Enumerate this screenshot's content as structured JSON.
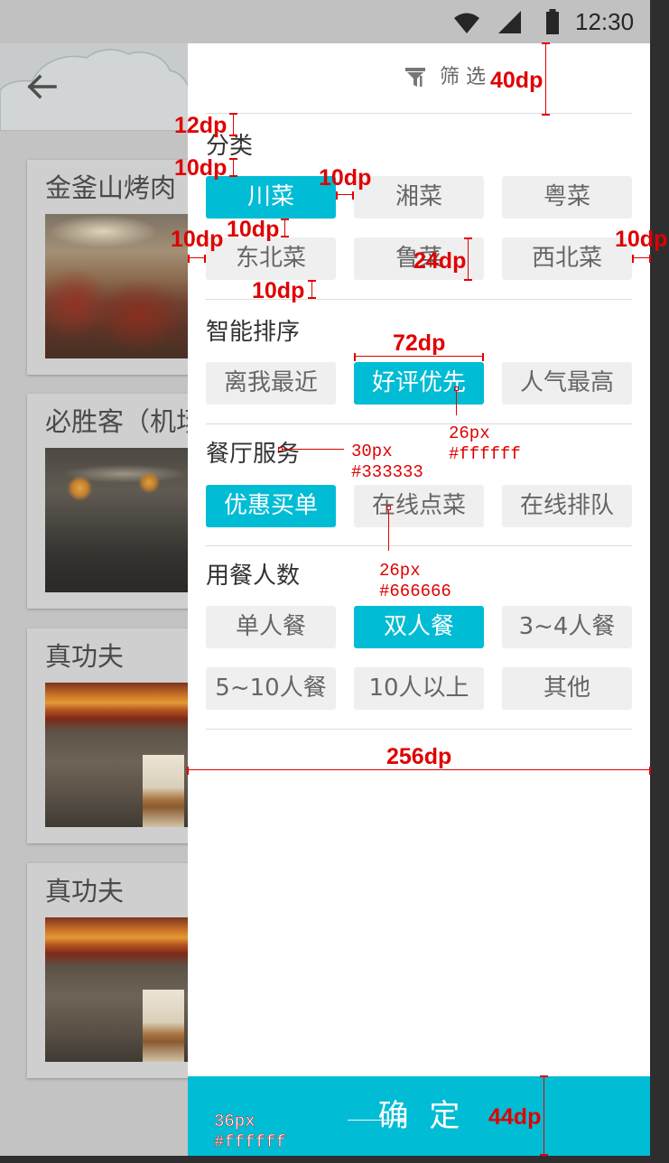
{
  "colors": {
    "accent": "#00bcd4",
    "annotation": "#e00000",
    "chip_bg": "#efefef",
    "chip_text": "#666666",
    "label_text": "#333333"
  },
  "status_bar": {
    "time": "12:30",
    "icons": [
      "wifi-icon",
      "cell-signal-icon",
      "battery-icon"
    ]
  },
  "background_page": {
    "back_icon": "arrow-left-icon",
    "header_decoration": "cloud-icon",
    "restaurants": [
      {
        "name": "金釜山烤肉"
      },
      {
        "name": "必胜客（机场"
      },
      {
        "name": "真功夫"
      },
      {
        "name": "真功夫"
      }
    ]
  },
  "filter_drawer": {
    "title_icon": "filter-icon",
    "title": "筛 选",
    "sections": [
      {
        "label": "分类",
        "options": [
          {
            "label": "川菜",
            "selected": true
          },
          {
            "label": "湘菜",
            "selected": false
          },
          {
            "label": "粤菜",
            "selected": false
          },
          {
            "label": "东北菜",
            "selected": false
          },
          {
            "label": "鲁菜",
            "selected": false
          },
          {
            "label": "西北菜",
            "selected": false
          }
        ]
      },
      {
        "label": "智能排序",
        "options": [
          {
            "label": "离我最近",
            "selected": false
          },
          {
            "label": "好评优先",
            "selected": true
          },
          {
            "label": "人气最高",
            "selected": false
          }
        ]
      },
      {
        "label": "餐厅服务",
        "options": [
          {
            "label": "优惠买单",
            "selected": true
          },
          {
            "label": "在线点菜",
            "selected": false
          },
          {
            "label": "在线排队",
            "selected": false
          }
        ]
      },
      {
        "label": "用餐人数",
        "options": [
          {
            "label": "单人餐",
            "selected": false
          },
          {
            "label": "双人餐",
            "selected": true
          },
          {
            "label": "3~4人餐",
            "selected": false
          },
          {
            "label": "5~10人餐",
            "selected": false
          },
          {
            "label": "10人以上",
            "selected": false
          },
          {
            "label": "其他",
            "selected": false
          }
        ]
      }
    ],
    "confirm_label": "确 定"
  },
  "spec_annotations": {
    "dimensions": [
      "40dp",
      "12dp",
      "10dp",
      "10dp",
      "10dp",
      "10dp",
      "24dp",
      "10dp",
      "10dp",
      "72dp",
      "256dp",
      "44dp"
    ],
    "font_notes": [
      {
        "size": "26px",
        "color": "#ffffff"
      },
      {
        "size": "30px",
        "color": "#333333"
      },
      {
        "size": "26px",
        "color": "#666666"
      },
      {
        "size": "36px",
        "color": "#ffffff"
      }
    ]
  }
}
